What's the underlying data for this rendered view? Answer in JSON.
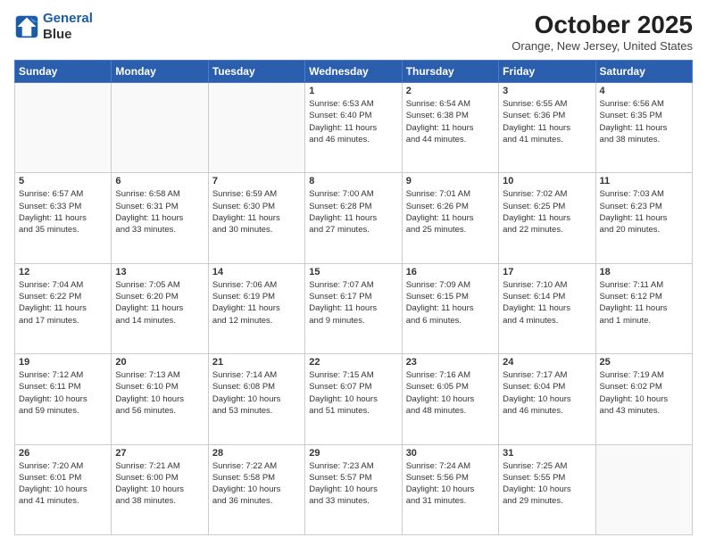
{
  "header": {
    "logo_line1": "General",
    "logo_line2": "Blue",
    "title": "October 2025",
    "location": "Orange, New Jersey, United States"
  },
  "weekdays": [
    "Sunday",
    "Monday",
    "Tuesday",
    "Wednesday",
    "Thursday",
    "Friday",
    "Saturday"
  ],
  "weeks": [
    [
      {
        "num": "",
        "info": ""
      },
      {
        "num": "",
        "info": ""
      },
      {
        "num": "",
        "info": ""
      },
      {
        "num": "1",
        "info": "Sunrise: 6:53 AM\nSunset: 6:40 PM\nDaylight: 11 hours\nand 46 minutes."
      },
      {
        "num": "2",
        "info": "Sunrise: 6:54 AM\nSunset: 6:38 PM\nDaylight: 11 hours\nand 44 minutes."
      },
      {
        "num": "3",
        "info": "Sunrise: 6:55 AM\nSunset: 6:36 PM\nDaylight: 11 hours\nand 41 minutes."
      },
      {
        "num": "4",
        "info": "Sunrise: 6:56 AM\nSunset: 6:35 PM\nDaylight: 11 hours\nand 38 minutes."
      }
    ],
    [
      {
        "num": "5",
        "info": "Sunrise: 6:57 AM\nSunset: 6:33 PM\nDaylight: 11 hours\nand 35 minutes."
      },
      {
        "num": "6",
        "info": "Sunrise: 6:58 AM\nSunset: 6:31 PM\nDaylight: 11 hours\nand 33 minutes."
      },
      {
        "num": "7",
        "info": "Sunrise: 6:59 AM\nSunset: 6:30 PM\nDaylight: 11 hours\nand 30 minutes."
      },
      {
        "num": "8",
        "info": "Sunrise: 7:00 AM\nSunset: 6:28 PM\nDaylight: 11 hours\nand 27 minutes."
      },
      {
        "num": "9",
        "info": "Sunrise: 7:01 AM\nSunset: 6:26 PM\nDaylight: 11 hours\nand 25 minutes."
      },
      {
        "num": "10",
        "info": "Sunrise: 7:02 AM\nSunset: 6:25 PM\nDaylight: 11 hours\nand 22 minutes."
      },
      {
        "num": "11",
        "info": "Sunrise: 7:03 AM\nSunset: 6:23 PM\nDaylight: 11 hours\nand 20 minutes."
      }
    ],
    [
      {
        "num": "12",
        "info": "Sunrise: 7:04 AM\nSunset: 6:22 PM\nDaylight: 11 hours\nand 17 minutes."
      },
      {
        "num": "13",
        "info": "Sunrise: 7:05 AM\nSunset: 6:20 PM\nDaylight: 11 hours\nand 14 minutes."
      },
      {
        "num": "14",
        "info": "Sunrise: 7:06 AM\nSunset: 6:19 PM\nDaylight: 11 hours\nand 12 minutes."
      },
      {
        "num": "15",
        "info": "Sunrise: 7:07 AM\nSunset: 6:17 PM\nDaylight: 11 hours\nand 9 minutes."
      },
      {
        "num": "16",
        "info": "Sunrise: 7:09 AM\nSunset: 6:15 PM\nDaylight: 11 hours\nand 6 minutes."
      },
      {
        "num": "17",
        "info": "Sunrise: 7:10 AM\nSunset: 6:14 PM\nDaylight: 11 hours\nand 4 minutes."
      },
      {
        "num": "18",
        "info": "Sunrise: 7:11 AM\nSunset: 6:12 PM\nDaylight: 11 hours\nand 1 minute."
      }
    ],
    [
      {
        "num": "19",
        "info": "Sunrise: 7:12 AM\nSunset: 6:11 PM\nDaylight: 10 hours\nand 59 minutes."
      },
      {
        "num": "20",
        "info": "Sunrise: 7:13 AM\nSunset: 6:10 PM\nDaylight: 10 hours\nand 56 minutes."
      },
      {
        "num": "21",
        "info": "Sunrise: 7:14 AM\nSunset: 6:08 PM\nDaylight: 10 hours\nand 53 minutes."
      },
      {
        "num": "22",
        "info": "Sunrise: 7:15 AM\nSunset: 6:07 PM\nDaylight: 10 hours\nand 51 minutes."
      },
      {
        "num": "23",
        "info": "Sunrise: 7:16 AM\nSunset: 6:05 PM\nDaylight: 10 hours\nand 48 minutes."
      },
      {
        "num": "24",
        "info": "Sunrise: 7:17 AM\nSunset: 6:04 PM\nDaylight: 10 hours\nand 46 minutes."
      },
      {
        "num": "25",
        "info": "Sunrise: 7:19 AM\nSunset: 6:02 PM\nDaylight: 10 hours\nand 43 minutes."
      }
    ],
    [
      {
        "num": "26",
        "info": "Sunrise: 7:20 AM\nSunset: 6:01 PM\nDaylight: 10 hours\nand 41 minutes."
      },
      {
        "num": "27",
        "info": "Sunrise: 7:21 AM\nSunset: 6:00 PM\nDaylight: 10 hours\nand 38 minutes."
      },
      {
        "num": "28",
        "info": "Sunrise: 7:22 AM\nSunset: 5:58 PM\nDaylight: 10 hours\nand 36 minutes."
      },
      {
        "num": "29",
        "info": "Sunrise: 7:23 AM\nSunset: 5:57 PM\nDaylight: 10 hours\nand 33 minutes."
      },
      {
        "num": "30",
        "info": "Sunrise: 7:24 AM\nSunset: 5:56 PM\nDaylight: 10 hours\nand 31 minutes."
      },
      {
        "num": "31",
        "info": "Sunrise: 7:25 AM\nSunset: 5:55 PM\nDaylight: 10 hours\nand 29 minutes."
      },
      {
        "num": "",
        "info": ""
      }
    ]
  ]
}
